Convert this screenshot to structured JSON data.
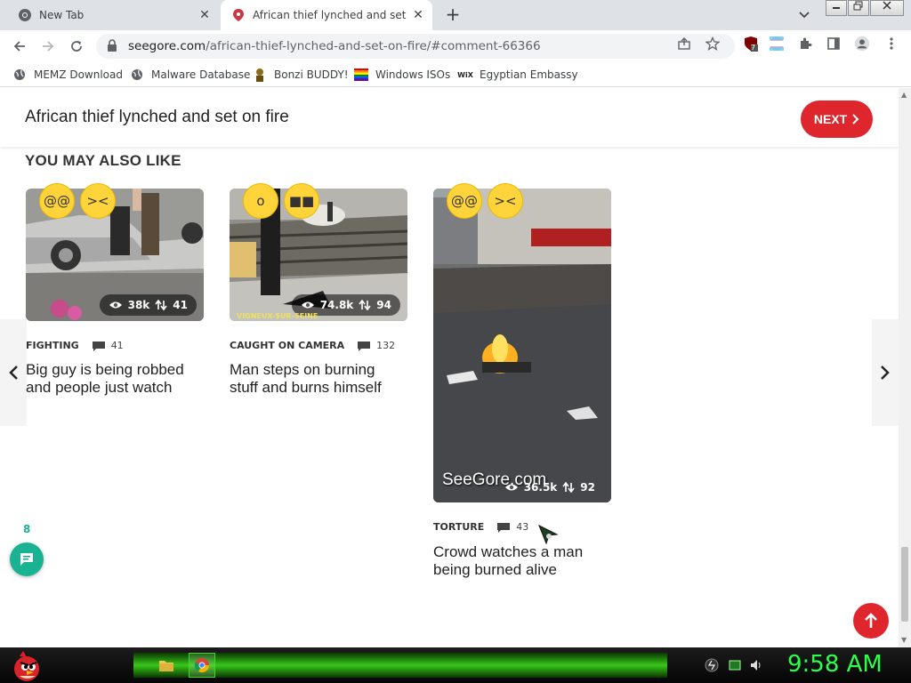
{
  "browser": {
    "tabs": [
      {
        "title": "New Tab",
        "active": false
      },
      {
        "title": "African thief lynched and set on fire",
        "active": true
      }
    ],
    "new_tab_glyph": "+",
    "close_glyph": "✕",
    "url_host": "seegore.com",
    "url_path": "/african-thief-lynched-and-set-on-fire/#comment-66366",
    "extension_badge": "7"
  },
  "bookmarks": [
    {
      "label": "MEMZ Download",
      "icon": "globe-icon"
    },
    {
      "label": "Malware Database",
      "icon": "globe-icon"
    },
    {
      "label": "Bonzi BUDDY!",
      "icon": "bonzi-icon"
    },
    {
      "label": "Windows ISOs",
      "icon": "rainbow-flag-icon"
    },
    {
      "label": "Egyptian Embassy",
      "icon": "wix-icon"
    }
  ],
  "page": {
    "article_title": "African thief lynched and set on fire",
    "next_label": "NEXT",
    "section_heading": "YOU MAY ALSO LIKE",
    "cards": [
      {
        "category": "FIGHTING",
        "comments": "41",
        "title": "Big guy is being robbed and people just watch",
        "views": "38k",
        "votes": "41"
      },
      {
        "category": "CAUGHT ON CAMERA",
        "comments": "132",
        "title": "Man steps on burning stuff and burns himself",
        "views": "74.8k",
        "votes": "94",
        "watermark": "VIGNEUX-SUR-SEINE"
      },
      {
        "category": "TORTURE",
        "comments": "43",
        "title": "Crowd watches a man being burned alive",
        "views": "36.5k",
        "votes": "92",
        "watermark": "SeeGore.com"
      }
    ],
    "chat_count": "8"
  },
  "taskbar": {
    "clock": "9:58 AM"
  },
  "colors": {
    "accent_red": "#e0262d",
    "chat_green": "#19b394",
    "clock_green": "#2aff4a"
  }
}
